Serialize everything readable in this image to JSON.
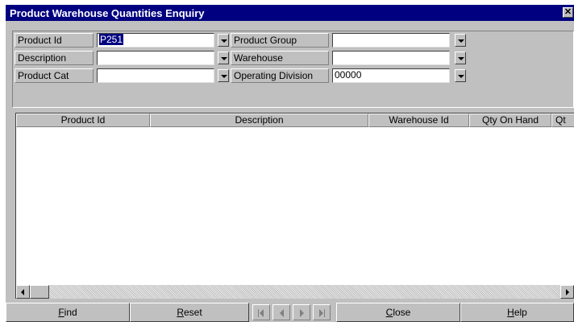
{
  "window": {
    "title": "Product Warehouse Quantities Enquiry",
    "close_glyph": "✕"
  },
  "criteria": {
    "product_id": {
      "label": "Product Id",
      "value": "P251"
    },
    "description": {
      "label": "Description",
      "value": ""
    },
    "product_cat": {
      "label": "Product Cat",
      "value": ""
    },
    "product_group": {
      "label": "Product Group",
      "value": ""
    },
    "warehouse": {
      "label": "Warehouse",
      "value": ""
    },
    "operating_division": {
      "label": "Operating Division",
      "value": "00000"
    }
  },
  "grid": {
    "columns": [
      "Product Id",
      "Description",
      "Warehouse Id",
      "Qty On Hand",
      "Qt"
    ],
    "rows": []
  },
  "toolbar": {
    "find": {
      "mnemonic": "F",
      "rest": "ind"
    },
    "reset": {
      "mnemonic": "R",
      "rest": "eset"
    },
    "close": {
      "mnemonic": "C",
      "rest": "lose"
    },
    "help": {
      "mnemonic": "H",
      "rest": "elp"
    }
  },
  "colors": {
    "titlebar": "#000080",
    "face": "#c0c0c0",
    "selection": "#000080"
  },
  "icons": [
    "close-icon",
    "dropdown-arrow-icon",
    "scroll-left-icon",
    "scroll-right-icon",
    "first-record-icon",
    "previous-record-icon",
    "next-record-icon",
    "last-record-icon"
  ]
}
